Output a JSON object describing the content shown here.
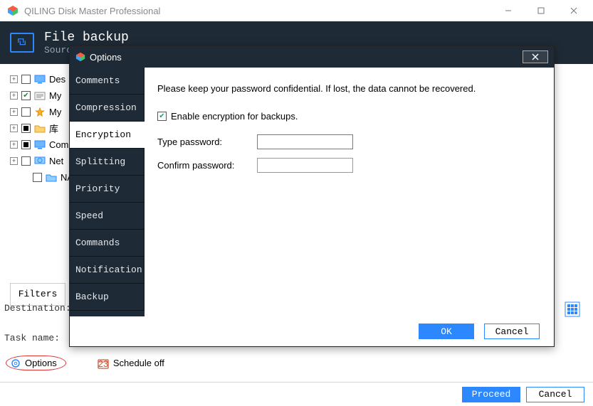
{
  "window": {
    "title": "QILING Disk Master Professional"
  },
  "header": {
    "title": "File backup",
    "subtitle": "Sourc"
  },
  "tree": [
    {
      "label": "Des",
      "state": "unchecked",
      "icon": "monitor"
    },
    {
      "label": "My",
      "state": "checked",
      "icon": "folder-doc"
    },
    {
      "label": "My",
      "state": "unchecked",
      "icon": "star"
    },
    {
      "label": "库",
      "state": "mixed",
      "icon": "folder-yellow"
    },
    {
      "label": "Com",
      "state": "mixed",
      "icon": "monitor"
    },
    {
      "label": "Net",
      "state": "unchecked",
      "icon": "monitor-net"
    },
    {
      "label": "NAS",
      "state": "unchecked",
      "icon": "folder-blue"
    }
  ],
  "filters_label": "Filters",
  "destination_label": "Destination:",
  "taskname_label": "Task name:",
  "options_link": "Options",
  "schedule_link": "Schedule off",
  "footer": {
    "proceed": "Proceed",
    "cancel": "Cancel"
  },
  "modal": {
    "title": "Options",
    "tabs": [
      "Comments",
      "Compression",
      "Encryption",
      "Splitting",
      "Priority",
      "Speed",
      "Commands",
      "Notification",
      "Backup"
    ],
    "active_tab_index": 2,
    "encryption": {
      "hint": "Please keep your password confidential. If lost, the data cannot be recovered.",
      "enable_label": "Enable encryption for backups.",
      "type_label": "Type password:",
      "confirm_label": "Confirm password:",
      "type_value": "",
      "confirm_value": ""
    },
    "ok": "OK",
    "cancel": "Cancel"
  }
}
